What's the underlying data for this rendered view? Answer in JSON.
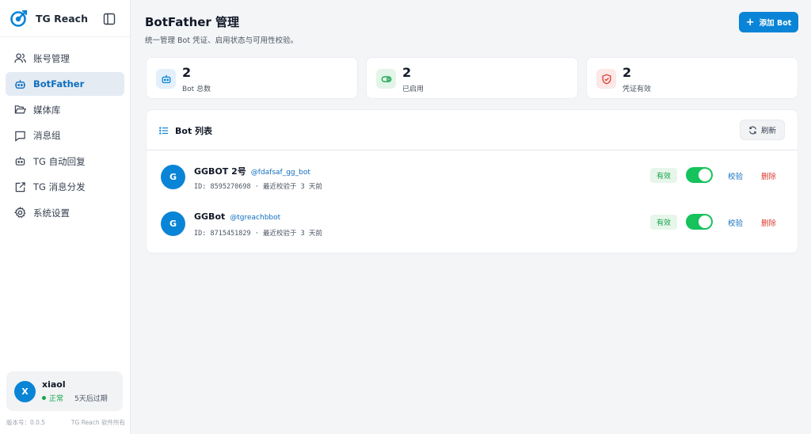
{
  "app": {
    "name": "TG Reach"
  },
  "sidebar": {
    "items": [
      {
        "label": "账号管理",
        "icon": "users-icon"
      },
      {
        "label": "BotFather",
        "icon": "bot-icon",
        "active": true
      },
      {
        "label": "媒体库",
        "icon": "folder-icon"
      },
      {
        "label": "消息组",
        "icon": "message-icon"
      },
      {
        "label": "TG 自动回复",
        "icon": "bot-reply-icon"
      },
      {
        "label": "TG 消息分发",
        "icon": "share-icon"
      },
      {
        "label": "系统设置",
        "icon": "gear-icon"
      }
    ],
    "user": {
      "initial": "X",
      "name": "xiaol",
      "status": "正常",
      "expiry": "5天后过期"
    },
    "footer": {
      "version": "版本号：0.0.5",
      "copyright": "TG Reach 软件所有"
    }
  },
  "header": {
    "title": "BotFather 管理",
    "subtitle": "统一管理 Bot 凭证、启用状态与可用性校验。",
    "add_label": "添加 Bot"
  },
  "stats": [
    {
      "value": "2",
      "label": "Bot 总数",
      "icon": "bot-icon",
      "color": "#0a84d6"
    },
    {
      "value": "2",
      "label": "已启用",
      "icon": "toggle-icon",
      "color": "#16a34a"
    },
    {
      "value": "2",
      "label": "凭证有效",
      "icon": "shield-icon",
      "color": "#dc3b2f"
    }
  ],
  "panel": {
    "title": "Bot 列表",
    "refresh_label": "刷新",
    "bots": [
      {
        "initial": "G",
        "name": "GGBOT 2号",
        "username": "@fdafsaf_gg_bot",
        "meta": "ID: 8595270698 · 最近校验于 3 天前",
        "status": "有效",
        "enabled": true,
        "verify": "校验",
        "delete": "删除"
      },
      {
        "initial": "G",
        "name": "GGBot",
        "username": "@tgreachbbot",
        "meta": "ID: 8715451829 · 最近校验于 3 天前",
        "status": "有效",
        "enabled": true,
        "verify": "校验",
        "delete": "删除"
      }
    ]
  },
  "colors": {
    "accent": "#0a84d6",
    "success": "#16a34a",
    "danger": "#dc3b2f",
    "toggle_on": "#16c25c"
  }
}
